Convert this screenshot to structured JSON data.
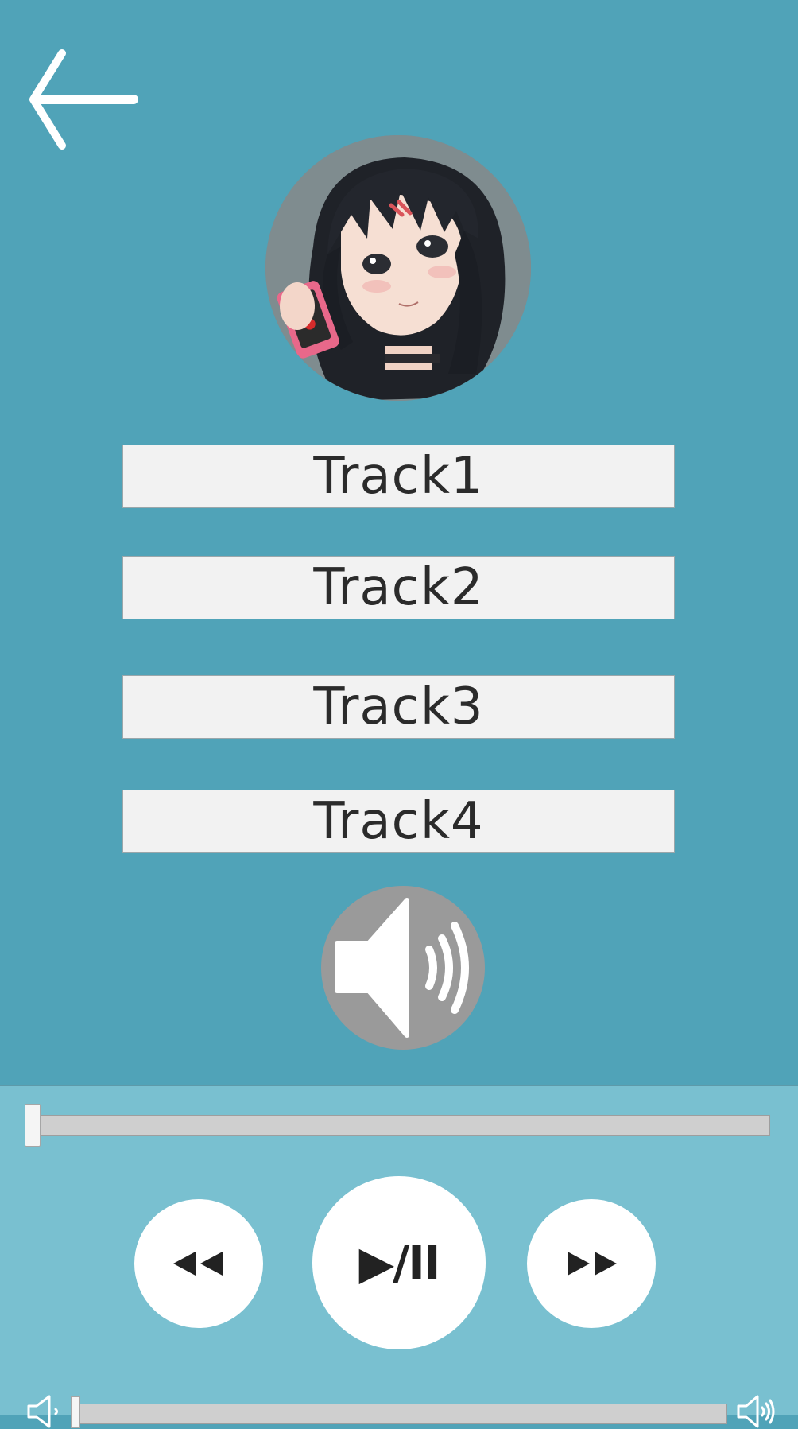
{
  "tracks": [
    {
      "label": "Track1"
    },
    {
      "label": "Track2"
    },
    {
      "label": "Track3"
    },
    {
      "label": "Track4"
    }
  ],
  "icons": {
    "back": "arrow-left-icon",
    "speaker": "speaker-loud-icon",
    "rewind": "rewind-icon",
    "forward": "fast-forward-icon",
    "volume_low": "volume-low-icon",
    "volume_high": "volume-high-icon"
  },
  "player": {
    "play_pause_label": "▶/II",
    "seek_position": 0,
    "volume_level": 0
  },
  "colors": {
    "background": "#50a3b8",
    "player_panel": "#79c0d0",
    "button_face": "#f2f2f2",
    "speaker_button": "#9a9a9a",
    "round_button": "#ffffff"
  }
}
